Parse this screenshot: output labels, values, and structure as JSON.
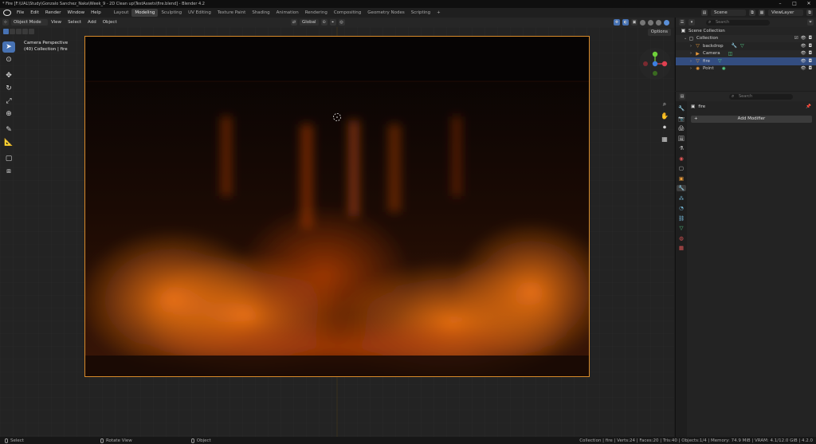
{
  "window": {
    "title": "* Fire [F:\\UAL\\Study\\Gonzalo Sanchez_Naka\\Week_9 - 2D Clean up\\TestAssets\\fire.blend] - Blender 4.2",
    "controls": [
      "–",
      "□",
      "✕"
    ]
  },
  "menu": [
    "File",
    "Edit",
    "Render",
    "Window",
    "Help"
  ],
  "workspaces": [
    "Layout",
    "Modeling",
    "Sculpting",
    "UV Editing",
    "Texture Paint",
    "Shading",
    "Animation",
    "Rendering",
    "Compositing",
    "Geometry Nodes",
    "Scripting",
    "+"
  ],
  "active_workspace": "Modeling",
  "scene": {
    "name": "Scene",
    "view_layer": "ViewLayer"
  },
  "viewport_header": {
    "mode": "Object Mode",
    "menus": [
      "View",
      "Select",
      "Add",
      "Object"
    ],
    "transform_orientation": "Global",
    "options_label": "Options"
  },
  "viewport_overlay": {
    "camera_title": "Camera Perspective",
    "camera_subtitle": "(40) Collection | fire"
  },
  "outliner": {
    "search_placeholder": "Search",
    "rows": [
      {
        "label": "Scene Collection"
      },
      {
        "label": "Collection"
      },
      {
        "label": "backdrop"
      },
      {
        "label": "Camera"
      },
      {
        "label": "fire"
      },
      {
        "label": "Point"
      }
    ]
  },
  "properties": {
    "search_placeholder": "Search",
    "object_name": "fire",
    "add_modifier_label": "Add Modifier"
  },
  "status_bar": {
    "select": "Select",
    "rotate": "Rotate View",
    "object": "Object",
    "stats": "Collection | fire | Verts:24 | Faces:20 | Tris:40 | Objects:1/4 | Memory: 74.9 MiB | VRAM: 4.1/12.0 GiB | 4.2.0"
  },
  "colors": {
    "accent": "#4772b3",
    "camera_frame": "#d88a2a",
    "fire_orange": "#e86a10",
    "selection": "#334d80"
  }
}
